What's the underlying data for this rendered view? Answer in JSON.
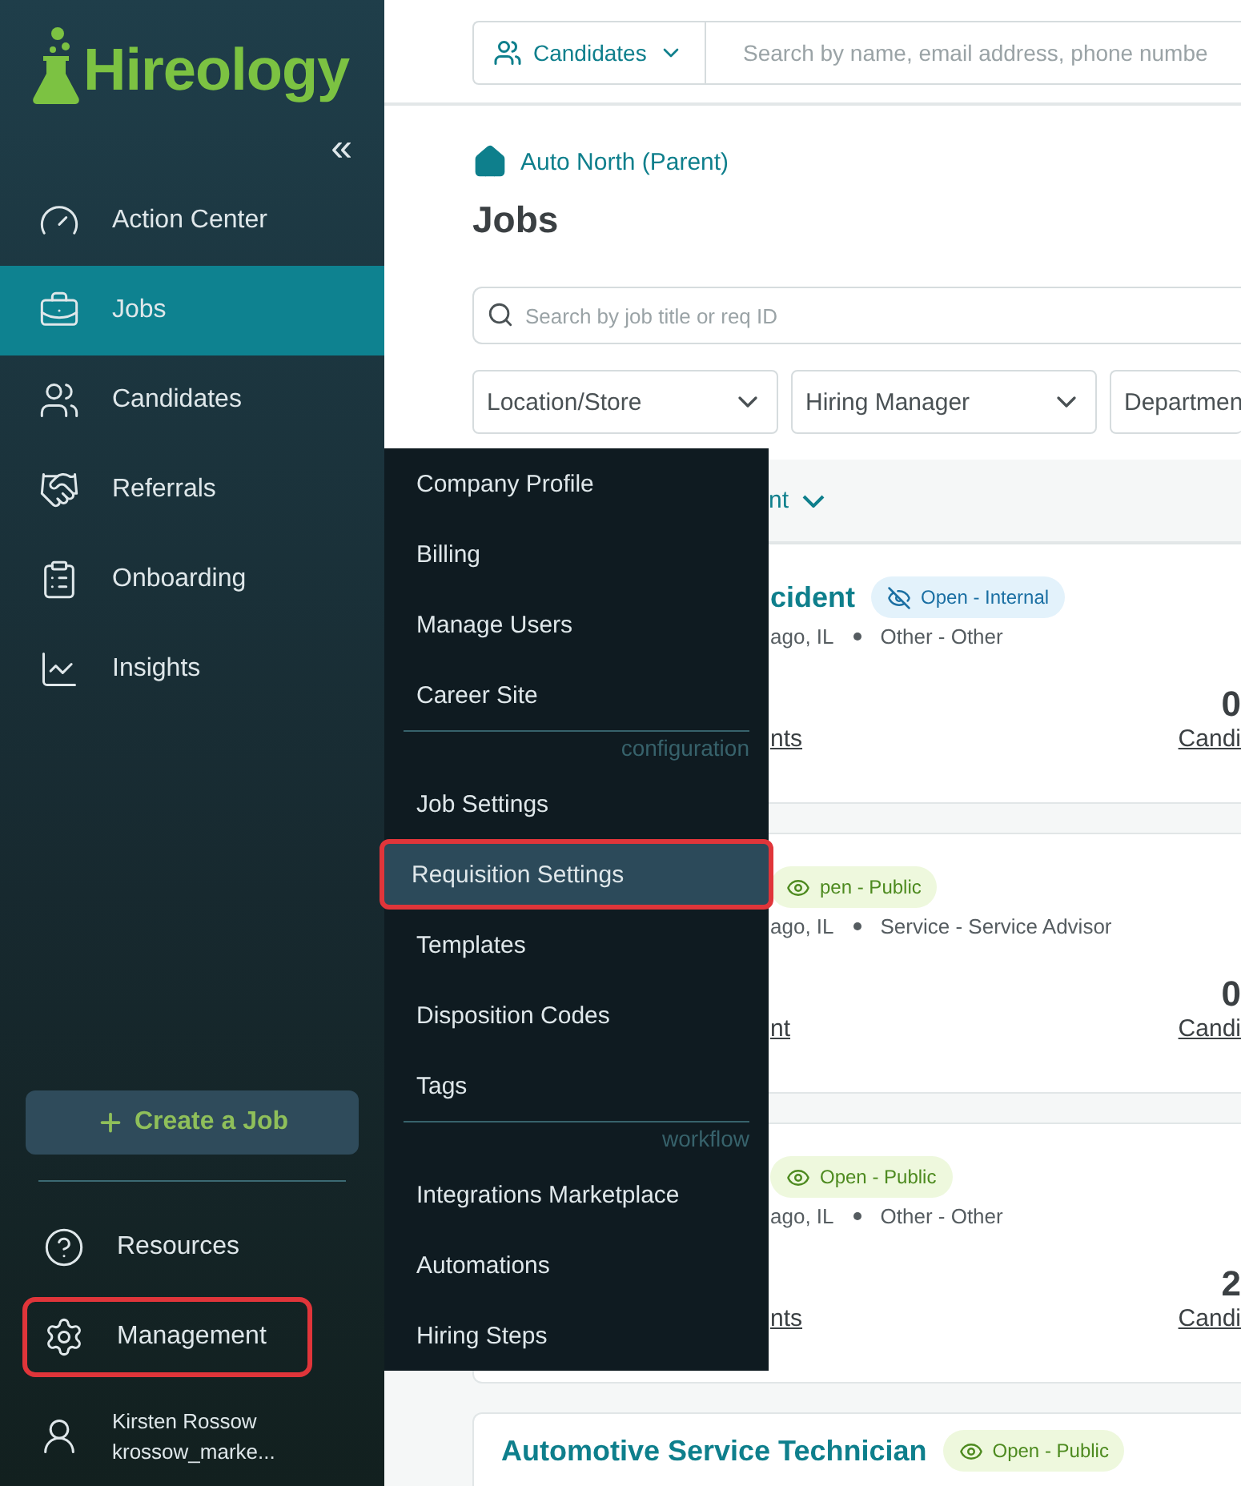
{
  "logo": {
    "text": "Hireology"
  },
  "sidebar": {
    "collapse": "«",
    "items": [
      {
        "label": "Action Center",
        "selected": false
      },
      {
        "label": "Jobs",
        "selected": true
      },
      {
        "label": "Candidates",
        "selected": false
      },
      {
        "label": "Referrals",
        "selected": false
      },
      {
        "label": "Onboarding",
        "selected": false
      },
      {
        "label": "Insights",
        "selected": false
      }
    ],
    "create_button": "Create a Job",
    "bottom_items": [
      {
        "label": "Resources",
        "outlined": false
      },
      {
        "label": "Management",
        "outlined": true
      }
    ],
    "user": {
      "name": "Kirsten Rossow",
      "account": "krossow_marke..."
    }
  },
  "topbar": {
    "scope": "Candidates",
    "search_placeholder": "Search by name, email address, phone numbe"
  },
  "breadcrumb": "Auto North (Parent)",
  "title": "Jobs",
  "job_search_placeholder": "Search by job title or req ID",
  "filters": [
    "Location/Store",
    "Hiring Manager",
    "Departmen"
  ],
  "sort_label": "nt",
  "jobs": [
    {
      "title": "cident",
      "badge": {
        "text": "Open - Internal",
        "kind": "internal"
      },
      "location": "ago, IL",
      "department": "Other - Other",
      "stat_label": "nts",
      "count": "0",
      "count_label": "Candi"
    },
    {
      "badge": {
        "text": "pen - Public",
        "kind": "public"
      },
      "location": "ago, IL",
      "department": "Service - Service Advisor",
      "stat_label": "nt",
      "count": "0",
      "count_label": "Candi"
    },
    {
      "badge": {
        "text": "Open - Public",
        "kind": "public"
      },
      "location": "ago, IL",
      "department": "Other - Other",
      "stat_label": "nts",
      "count": "2",
      "count_label": "Candi"
    },
    {
      "title": "Automotive Service Technician",
      "badge": {
        "text": "Open - Public",
        "kind": "public"
      },
      "kind": "full"
    }
  ],
  "menu": {
    "sections": [
      {
        "items": [
          {
            "label": "Company Profile",
            "selected": false,
            "outlined": false
          },
          {
            "label": "Billing",
            "selected": false,
            "outlined": false
          },
          {
            "label": "Manage Users",
            "selected": false,
            "outlined": false
          },
          {
            "label": "Career Site",
            "selected": false,
            "outlined": false
          }
        ]
      },
      {
        "heading": "configuration",
        "items": [
          {
            "label": "Job Settings",
            "selected": false,
            "outlined": false
          },
          {
            "label": "Requisition Settings",
            "selected": true,
            "outlined": true
          },
          {
            "label": "Templates",
            "selected": false,
            "outlined": false
          },
          {
            "label": "Disposition Codes",
            "selected": false,
            "outlined": false
          },
          {
            "label": "Tags",
            "selected": false,
            "outlined": false
          }
        ]
      },
      {
        "heading": "workflow",
        "items": [
          {
            "label": "Integrations Marketplace",
            "selected": false,
            "outlined": false
          },
          {
            "label": "Automations",
            "selected": false,
            "outlined": false
          },
          {
            "label": "Hiring Steps",
            "selected": false,
            "outlined": false
          }
        ]
      }
    ]
  }
}
